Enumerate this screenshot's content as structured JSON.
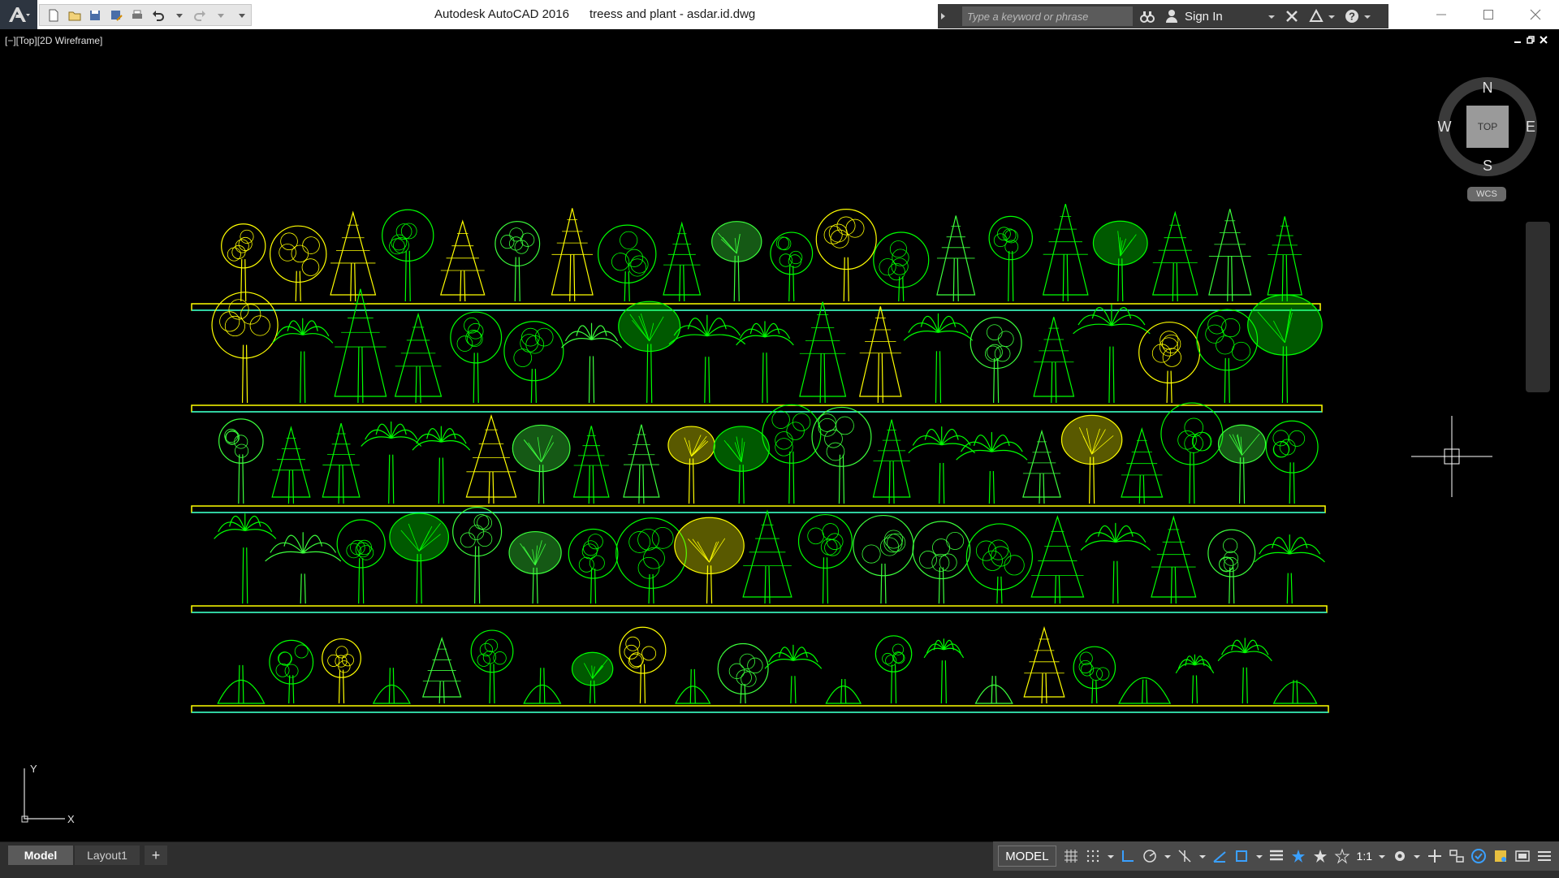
{
  "window": {
    "app_name": "Autodesk AutoCAD 2016",
    "file_name": "treess and plant - asdar.id.dwg"
  },
  "header": {
    "search_placeholder": "Type a keyword or phrase",
    "sign_in_label": "Sign In"
  },
  "viewport": {
    "label": "[−][Top][2D Wireframe]"
  },
  "viewcube": {
    "north": "N",
    "south": "S",
    "east": "E",
    "west": "W",
    "face": "TOP",
    "ucs_label": "WCS"
  },
  "ucs_icon": {
    "x_label": "X",
    "y_label": "Y"
  },
  "layout_tabs": {
    "model": "Model",
    "layout1": "Layout1",
    "add": "+"
  },
  "statusbar": {
    "model_label": "MODEL",
    "annotation_scale": "1:1"
  },
  "colors": {
    "green": "#00ff00",
    "yellow": "#ffff00",
    "cyan": "#00ffff",
    "bright_green": "#3cff3c"
  }
}
